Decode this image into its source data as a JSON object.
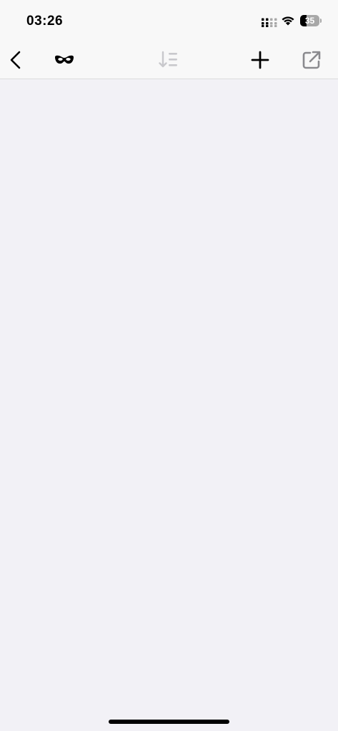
{
  "status_bar": {
    "time": "03:26",
    "battery_level": "35",
    "battery_percent": 35,
    "signal_icon": "cellular-signal-icon",
    "wifi_icon": "wifi-icon"
  },
  "toolbar": {
    "buttons": [
      {
        "icon": "chevron-left-icon",
        "enabled": true
      },
      {
        "icon": "incognito-mask-icon",
        "enabled": true
      },
      {
        "icon": "sort-descending-icon",
        "enabled": false
      },
      {
        "icon": "plus-icon",
        "enabled": true
      },
      {
        "icon": "share-external-icon",
        "enabled": true
      }
    ]
  },
  "colors": {
    "background": "#f2f1f6",
    "bar_background": "#f8f8f8",
    "icon_active": "#000000",
    "icon_disabled": "#c8c8cc",
    "icon_secondary": "#8a8a8e"
  }
}
